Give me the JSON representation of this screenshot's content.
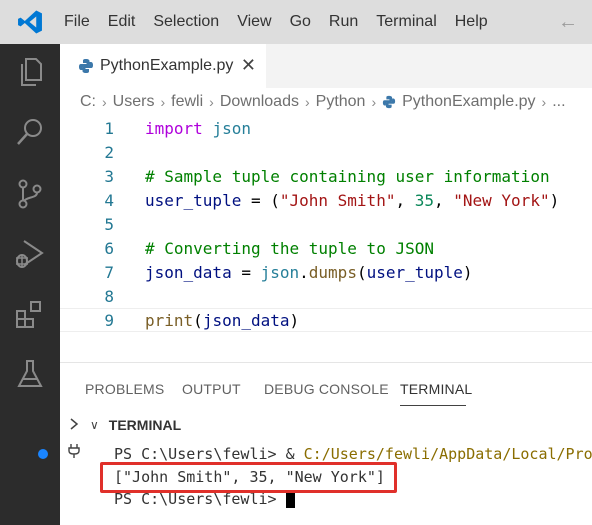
{
  "menubar": {
    "items": [
      "File",
      "Edit",
      "Selection",
      "View",
      "Go",
      "Run",
      "Terminal",
      "Help"
    ],
    "back_icon": "arrow-left-icon",
    "logo": "vscode-logo"
  },
  "activitybar": {
    "icons": [
      "explorer-icon",
      "search-icon",
      "source-control-icon",
      "run-debug-icon",
      "extensions-icon",
      "testing-icon"
    ]
  },
  "tab": {
    "label": "PythonExample.py",
    "icon": "python-icon",
    "close_icon": "close-icon"
  },
  "breadcrumb": [
    "C:",
    "Users",
    "fewli",
    "Downloads",
    "Python",
    "PythonExample.py",
    "..."
  ],
  "editor": {
    "lines": [
      {
        "num": "1",
        "tokens": [
          {
            "t": "import",
            "c": "kw"
          },
          {
            "t": " "
          },
          {
            "t": "json",
            "c": "mod"
          }
        ]
      },
      {
        "num": "2",
        "tokens": []
      },
      {
        "num": "3",
        "tokens": [
          {
            "t": "# Sample tuple containing user information",
            "c": "cm"
          }
        ]
      },
      {
        "num": "4",
        "tokens": [
          {
            "t": "user_tuple",
            "c": "var"
          },
          {
            "t": " = ("
          },
          {
            "t": "\"John Smith\"",
            "c": "str"
          },
          {
            "t": ", "
          },
          {
            "t": "35",
            "c": "num"
          },
          {
            "t": ", "
          },
          {
            "t": "\"New York\"",
            "c": "str"
          },
          {
            "t": ")"
          }
        ]
      },
      {
        "num": "5",
        "tokens": []
      },
      {
        "num": "6",
        "tokens": [
          {
            "t": "# Converting the tuple to JSON",
            "c": "cm"
          }
        ]
      },
      {
        "num": "7",
        "tokens": [
          {
            "t": "json_data",
            "c": "var"
          },
          {
            "t": " = "
          },
          {
            "t": "json",
            "c": "mod"
          },
          {
            "t": "."
          },
          {
            "t": "dumps",
            "c": "fn"
          },
          {
            "t": "("
          },
          {
            "t": "user_tuple",
            "c": "var"
          },
          {
            "t": ")"
          }
        ]
      },
      {
        "num": "8",
        "tokens": []
      },
      {
        "num": "9",
        "tokens": [
          {
            "t": "print",
            "c": "fn"
          },
          {
            "t": "("
          },
          {
            "t": "json_data",
            "c": "var"
          },
          {
            "t": ")"
          }
        ]
      }
    ],
    "current_line": "9"
  },
  "panel": {
    "tabs": [
      "PROBLEMS",
      "OUTPUT",
      "DEBUG CONSOLE",
      "TERMINAL"
    ],
    "active_tab": "TERMINAL",
    "terminal_header": "TERMINAL",
    "terminal": {
      "line1_prompt": "PS C:\\Users\\fewli> & ",
      "line1_path": "C:/Users/fewli/AppData/Local/Pro",
      "line2": "[\"John Smith\", 35, \"New York\"]",
      "line3_prompt": "PS C:\\Users\\fewli> "
    }
  },
  "colors": {
    "menubar_bg": "#dddddd",
    "activitybar_bg": "#2c2c2c",
    "highlight_border": "#e0302a",
    "terminal_dot": "#1a85ff"
  }
}
